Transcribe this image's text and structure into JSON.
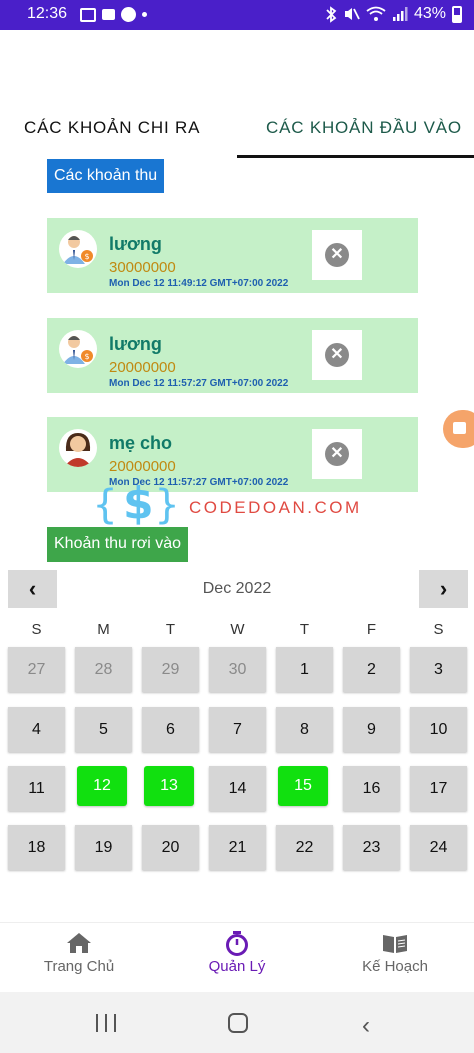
{
  "status_bar": {
    "time": "12:36",
    "battery": "43%"
  },
  "tabs": [
    {
      "label": "CÁC KHOẢN CHI RA",
      "selected": false
    },
    {
      "label": "CÁC KHOẢN ĐẦU VÀO",
      "selected": true
    }
  ],
  "income_section": {
    "title": "Các khoản thu"
  },
  "income_items": [
    {
      "name": "lương",
      "amount": "30000000",
      "date": "Mon Dec 12 11:49:12 GMT+07:00 2022",
      "avatar_icon": "male-office-worker-money-icon"
    },
    {
      "name": "lương",
      "amount": "20000000",
      "date": "Mon Dec 12 11:57:27 GMT+07:00 2022",
      "avatar_icon": "male-office-worker-money-icon"
    },
    {
      "name": "mẹ cho",
      "amount": "20000000",
      "date": "Mon Dec 12 11:57:27 GMT+07:00 2022",
      "avatar_icon": "woman-avatar-icon"
    }
  ],
  "watermark": {
    "text": "CODEDOAN.COM"
  },
  "calendar_section": {
    "title": "Khoản thu rơi vào"
  },
  "calendar": {
    "month_label": "Dec 2022",
    "weekdays": [
      "S",
      "M",
      "T",
      "W",
      "T",
      "F",
      "S"
    ],
    "weeks": [
      [
        {
          "day": "27",
          "other": true
        },
        {
          "day": "28",
          "other": true
        },
        {
          "day": "29",
          "other": true
        },
        {
          "day": "30",
          "other": true
        },
        {
          "day": "1"
        },
        {
          "day": "2"
        },
        {
          "day": "3"
        }
      ],
      [
        {
          "day": "4"
        },
        {
          "day": "5"
        },
        {
          "day": "6"
        },
        {
          "day": "7"
        },
        {
          "day": "8"
        },
        {
          "day": "9"
        },
        {
          "day": "10"
        }
      ],
      [
        {
          "day": "11"
        },
        {
          "day": "12",
          "marked": true
        },
        {
          "day": "13",
          "marked": true
        },
        {
          "day": "14"
        },
        {
          "day": "15",
          "marked": true
        },
        {
          "day": "16"
        },
        {
          "day": "17"
        }
      ],
      [
        {
          "day": "18"
        },
        {
          "day": "19"
        },
        {
          "day": "20"
        },
        {
          "day": "21"
        },
        {
          "day": "22"
        },
        {
          "day": "23"
        },
        {
          "day": "24"
        }
      ]
    ]
  },
  "bottom_nav": [
    {
      "label": "Trang Chủ",
      "icon": "home-icon",
      "active": false
    },
    {
      "label": "Quản Lý",
      "icon": "stopwatch-icon",
      "active": true
    },
    {
      "label": "Kế Hoạch",
      "icon": "book-icon",
      "active": false
    }
  ],
  "colors": {
    "status_bar": "#4a1fc9",
    "accent_active": "#6a1bb5",
    "card_bg": "#c5f0c8",
    "marked_day": "#11e00f"
  }
}
